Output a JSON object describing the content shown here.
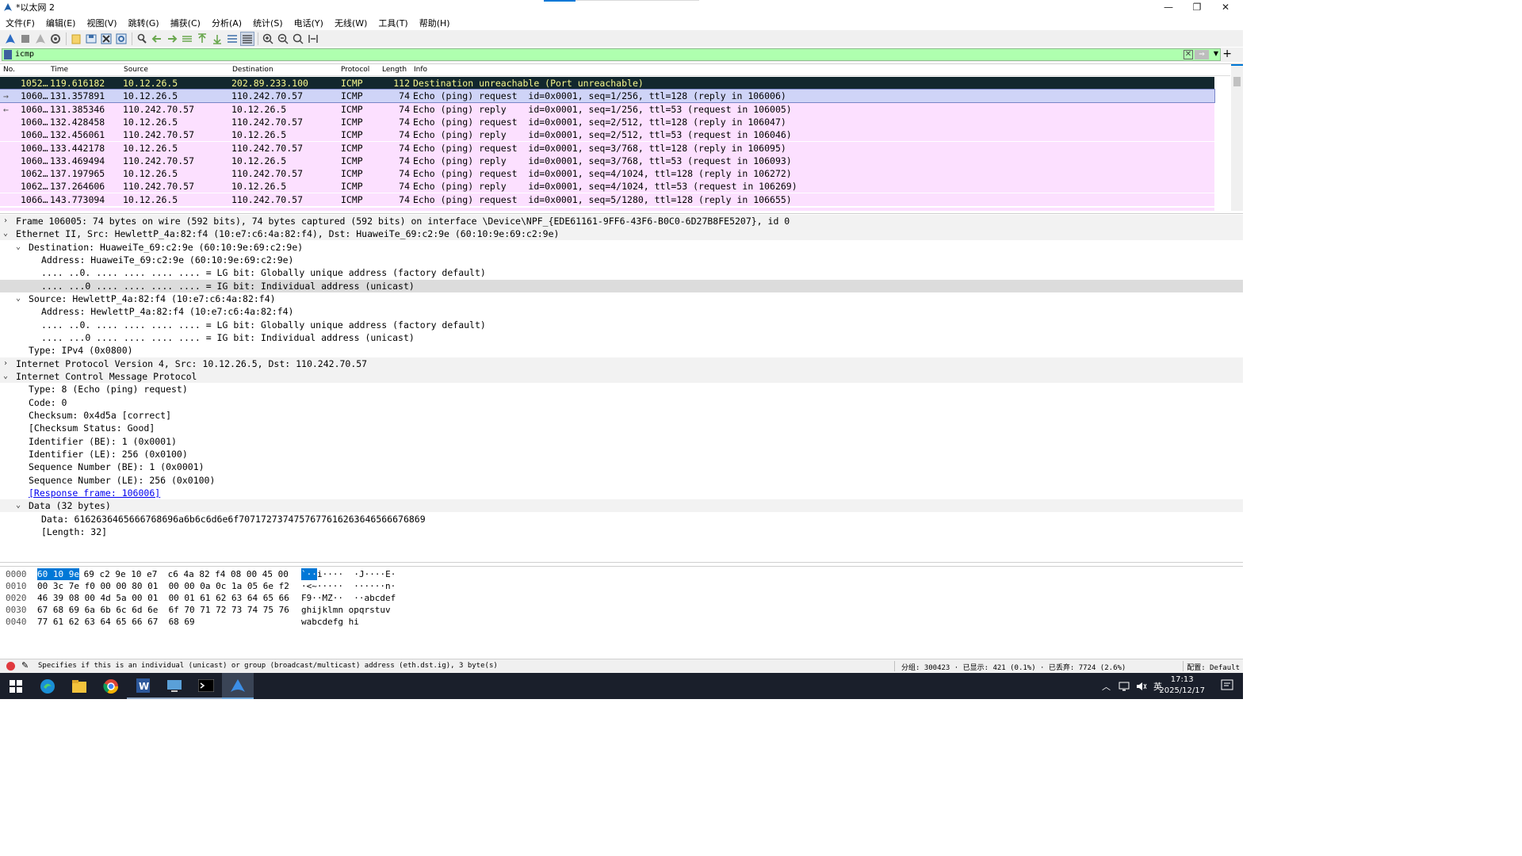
{
  "window": {
    "title": "*以太网 2",
    "minimize": "—",
    "maximize": "❐",
    "close": "✕"
  },
  "menu": [
    "文件(F)",
    "编辑(E)",
    "视图(V)",
    "跳转(G)",
    "捕获(C)",
    "分析(A)",
    "统计(S)",
    "电话(Y)",
    "无线(W)",
    "工具(T)",
    "帮助(H)"
  ],
  "filter": {
    "value": "icmp",
    "plus": "+"
  },
  "packet_list": {
    "columns": [
      "No.",
      "Time",
      "Source",
      "Destination",
      "Protocol",
      "Length",
      "Info"
    ],
    "rows": [
      {
        "no": "1052…",
        "time": "119.616182",
        "src": "10.12.26.5",
        "dst": "202.89.233.100",
        "proto": "ICMP",
        "len": "112",
        "info": "Destination unreachable (Port unreachable)",
        "style": "error"
      },
      {
        "no": "1060…",
        "time": "131.357891",
        "src": "10.12.26.5",
        "dst": "110.242.70.57",
        "proto": "ICMP",
        "len": "74",
        "info": "Echo (ping) request  id=0x0001, seq=1/256, ttl=128 (reply in 106006)",
        "style": "selected"
      },
      {
        "no": "1060…",
        "time": "131.385346",
        "src": "110.242.70.57",
        "dst": "10.12.26.5",
        "proto": "ICMP",
        "len": "74",
        "info": "Echo (ping) reply    id=0x0001, seq=1/256, ttl=53 (request in 106005)",
        "style": "normal"
      },
      {
        "no": "1060…",
        "time": "132.428458",
        "src": "10.12.26.5",
        "dst": "110.242.70.57",
        "proto": "ICMP",
        "len": "74",
        "info": "Echo (ping) request  id=0x0001, seq=2/512, ttl=128 (reply in 106047)",
        "style": "normal"
      },
      {
        "no": "1060…",
        "time": "132.456061",
        "src": "110.242.70.57",
        "dst": "10.12.26.5",
        "proto": "ICMP",
        "len": "74",
        "info": "Echo (ping) reply    id=0x0001, seq=2/512, ttl=53 (request in 106046)",
        "style": "normal"
      },
      {
        "no": "1060…",
        "time": "133.442178",
        "src": "10.12.26.5",
        "dst": "110.242.70.57",
        "proto": "ICMP",
        "len": "74",
        "info": "Echo (ping) request  id=0x0001, seq=3/768, ttl=128 (reply in 106095)",
        "style": "normal"
      },
      {
        "no": "1060…",
        "time": "133.469494",
        "src": "110.242.70.57",
        "dst": "10.12.26.5",
        "proto": "ICMP",
        "len": "74",
        "info": "Echo (ping) reply    id=0x0001, seq=3/768, ttl=53 (request in 106093)",
        "style": "normal"
      },
      {
        "no": "1062…",
        "time": "137.197965",
        "src": "10.12.26.5",
        "dst": "110.242.70.57",
        "proto": "ICMP",
        "len": "74",
        "info": "Echo (ping) request  id=0x0001, seq=4/1024, ttl=128 (reply in 106272)",
        "style": "normal"
      },
      {
        "no": "1062…",
        "time": "137.264606",
        "src": "110.242.70.57",
        "dst": "10.12.26.5",
        "proto": "ICMP",
        "len": "74",
        "info": "Echo (ping) reply    id=0x0001, seq=4/1024, ttl=53 (request in 106269)",
        "style": "normal"
      },
      {
        "no": "1066…",
        "time": "143.773094",
        "src": "10.12.26.5",
        "dst": "110.242.70.57",
        "proto": "ICMP",
        "len": "74",
        "info": "Echo (ping) request  id=0x0001, seq=5/1280, ttl=128 (reply in 106655)",
        "style": "normal"
      }
    ]
  },
  "details": [
    {
      "indent": 0,
      "arrow": "›",
      "text": "Frame 106005: 74 bytes on wire (592 bits), 74 bytes captured (592 bits) on interface \\Device\\NPF_{EDE61161-9FF6-43F6-B0C0-6D27B8FE5207}, id 0",
      "style": "alt"
    },
    {
      "indent": 0,
      "arrow": "⌄",
      "text": "Ethernet II, Src: HewlettP_4a:82:f4 (10:e7:c6:4a:82:f4), Dst: HuaweiTe_69:c2:9e (60:10:9e:69:c2:9e)",
      "style": "alt"
    },
    {
      "indent": 1,
      "arrow": "⌄",
      "text": "Destination: HuaweiTe_69:c2:9e (60:10:9e:69:c2:9e)",
      "style": ""
    },
    {
      "indent": 2,
      "arrow": "",
      "text": "Address: HuaweiTe_69:c2:9e (60:10:9e:69:c2:9e)",
      "style": ""
    },
    {
      "indent": 2,
      "arrow": "",
      "text": ".... ..0. .... .... .... .... = LG bit: Globally unique address (factory default)",
      "style": ""
    },
    {
      "indent": 2,
      "arrow": "",
      "text": ".... ...0 .... .... .... .... = IG bit: Individual address (unicast)",
      "style": "sel"
    },
    {
      "indent": 1,
      "arrow": "⌄",
      "text": "Source: HewlettP_4a:82:f4 (10:e7:c6:4a:82:f4)",
      "style": ""
    },
    {
      "indent": 2,
      "arrow": "",
      "text": "Address: HewlettP_4a:82:f4 (10:e7:c6:4a:82:f4)",
      "style": ""
    },
    {
      "indent": 2,
      "arrow": "",
      "text": ".... ..0. .... .... .... .... = LG bit: Globally unique address (factory default)",
      "style": ""
    },
    {
      "indent": 2,
      "arrow": "",
      "text": ".... ...0 .... .... .... .... = IG bit: Individual address (unicast)",
      "style": ""
    },
    {
      "indent": 1,
      "arrow": "",
      "text": "Type: IPv4 (0x0800)",
      "style": ""
    },
    {
      "indent": 0,
      "arrow": "›",
      "text": "Internet Protocol Version 4, Src: 10.12.26.5, Dst: 110.242.70.57",
      "style": "alt"
    },
    {
      "indent": 0,
      "arrow": "⌄",
      "text": "Internet Control Message Protocol",
      "style": "alt"
    },
    {
      "indent": 1,
      "arrow": "",
      "text": "Type: 8 (Echo (ping) request)",
      "style": ""
    },
    {
      "indent": 1,
      "arrow": "",
      "text": "Code: 0",
      "style": ""
    },
    {
      "indent": 1,
      "arrow": "",
      "text": "Checksum: 0x4d5a [correct]",
      "style": ""
    },
    {
      "indent": 1,
      "arrow": "",
      "text": "[Checksum Status: Good]",
      "style": ""
    },
    {
      "indent": 1,
      "arrow": "",
      "text": "Identifier (BE): 1 (0x0001)",
      "style": ""
    },
    {
      "indent": 1,
      "arrow": "",
      "text": "Identifier (LE): 256 (0x0100)",
      "style": ""
    },
    {
      "indent": 1,
      "arrow": "",
      "text": "Sequence Number (BE): 1 (0x0001)",
      "style": ""
    },
    {
      "indent": 1,
      "arrow": "",
      "text": "Sequence Number (LE): 256 (0x0100)",
      "style": ""
    },
    {
      "indent": 1,
      "arrow": "",
      "text": "[Response frame: 106006]",
      "style": "link"
    },
    {
      "indent": 1,
      "arrow": "⌄",
      "text": "Data (32 bytes)",
      "style": "alt"
    },
    {
      "indent": 2,
      "arrow": "",
      "text": "Data: 6162636465666768696a6b6c6d6e6f7071727374757677616263646566676869",
      "style": ""
    },
    {
      "indent": 2,
      "arrow": "",
      "text": "[Length: 32]",
      "style": ""
    }
  ],
  "bytes": [
    {
      "off": "0000",
      "hex_sel": "60 10 9e",
      "hex": " 69 c2 9e 10 e7  c6 4a 82 f4 08 00 45 00",
      "ascii_sel": "`··",
      "ascii": "i····  ·J····E·"
    },
    {
      "off": "0010",
      "hex_sel": "",
      "hex": "00 3c 7e f0 00 00 80 01  00 00 0a 0c 1a 05 6e f2",
      "ascii_sel": "",
      "ascii": "·<~·····  ······n·"
    },
    {
      "off": "0020",
      "hex_sel": "",
      "hex": "46 39 08 00 4d 5a 00 01  00 01 61 62 63 64 65 66",
      "ascii_sel": "",
      "ascii": "F9··MZ··  ··abcdef"
    },
    {
      "off": "0030",
      "hex_sel": "",
      "hex": "67 68 69 6a 6b 6c 6d 6e  6f 70 71 72 73 74 75 76",
      "ascii_sel": "",
      "ascii": "ghijklmn opqrstuv"
    },
    {
      "off": "0040",
      "hex_sel": "",
      "hex": "77 61 62 63 64 65 66 67  68 69",
      "ascii_sel": "",
      "ascii": "wabcdefg hi"
    }
  ],
  "status": {
    "message": "Specifies if this is an individual (unicast) or group (broadcast/multicast) address (eth.dst.ig), 3 byte(s)",
    "stats": "分组: 300423 · 已显示: 421 (0.1%) · 已丢弃: 7724 (2.6%)",
    "profile": "配置: Default"
  },
  "taskbar": {
    "time": "17:13",
    "date": "2025/12/17",
    "ime": "英"
  },
  "colors": {
    "filter_bg": "#afffaf",
    "icmp_row": "#fce0ff",
    "error_row": "#12272e",
    "error_text": "#f7f78d",
    "selected_row": "#cfd4f7"
  }
}
